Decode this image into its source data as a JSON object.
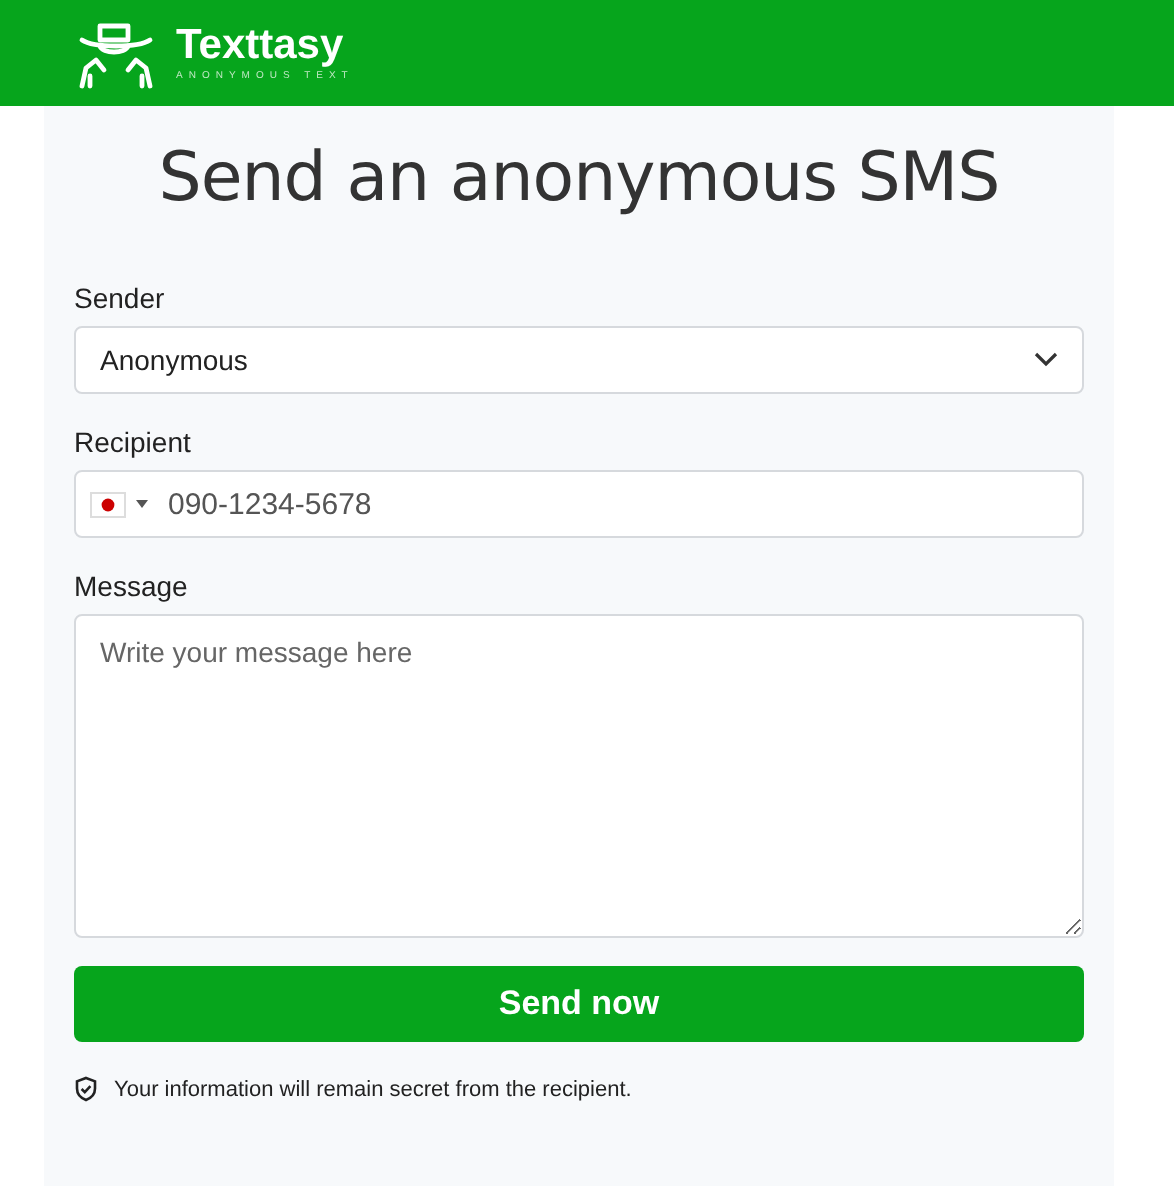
{
  "header": {
    "brand": "Texttasy",
    "tagline": "ANONYMOUS TEXT"
  },
  "title": "Send an anonymous SMS",
  "sender": {
    "label": "Sender",
    "value": "Anonymous"
  },
  "recipient": {
    "label": "Recipient",
    "placeholder": "090-1234-5678"
  },
  "message": {
    "label": "Message",
    "placeholder": "Write your message here"
  },
  "submit": "Send now",
  "note": "Your information will remain secret from the recipient."
}
